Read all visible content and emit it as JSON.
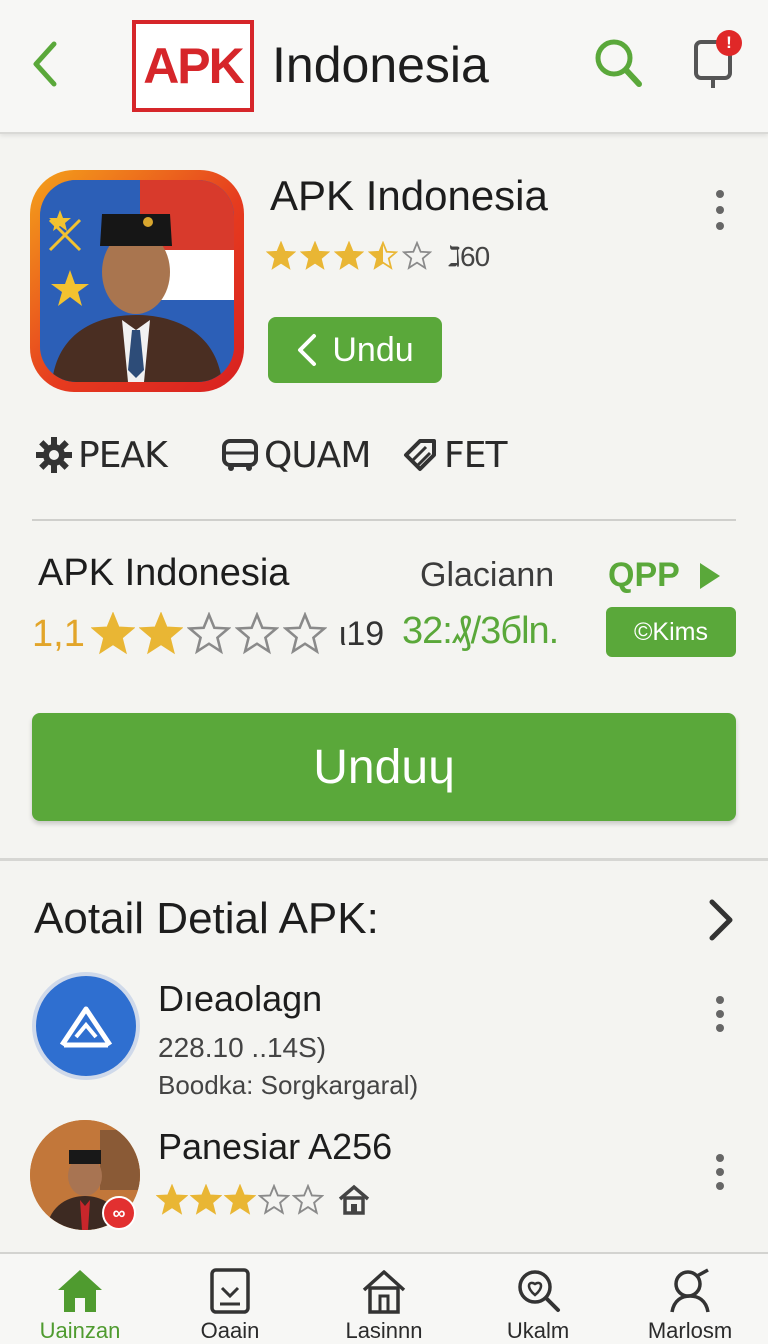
{
  "topbar": {
    "logo_text": "APK",
    "title": "Indonesia",
    "notification_count": "!"
  },
  "app": {
    "name": "APK Indonesia",
    "rating": 3.5,
    "rating_count": "ℷ60",
    "small_download_label": "Undu"
  },
  "tags": [
    {
      "label": "PEAK",
      "icon": "gear-icon"
    },
    {
      "label": "QUAM",
      "icon": "bus-icon"
    },
    {
      "label": "FET",
      "icon": "tag-icon"
    }
  ],
  "details": {
    "name": "APK Indonesia",
    "rating_number": "1,1",
    "rating": 2,
    "rating_count": "ι19",
    "category": "Glaciann",
    "size": "32:₰/3бln.",
    "store_label": "QPP",
    "badge_label": "©Kims"
  },
  "download_button_label": "Unduɥ",
  "section": {
    "title": "Aotail Detial APK:",
    "items": [
      {
        "title": "Dıeaolagn",
        "line1": "228.10 ..14S)",
        "line2": "Boodka: Sorgkargaral)",
        "icon": "image-icon"
      },
      {
        "title": "Panesiar A256",
        "rating": 3,
        "icon": "person-icon"
      }
    ]
  },
  "bottom_nav": [
    {
      "label": "Uainzan",
      "icon": "home-icon",
      "active": true
    },
    {
      "label": "Oaain",
      "icon": "tablet-icon",
      "active": false
    },
    {
      "label": "Lasinnn",
      "icon": "house-outline-icon",
      "active": false
    },
    {
      "label": "Ukalm",
      "icon": "search-heart-icon",
      "active": false
    },
    {
      "label": "Marlosm",
      "icon": "person-key-icon",
      "active": false
    }
  ],
  "colors": {
    "accent_green": "#5aa83a",
    "logo_red": "#d6262a",
    "star_gold": "#e9b634",
    "background": "#f4f4f1"
  }
}
